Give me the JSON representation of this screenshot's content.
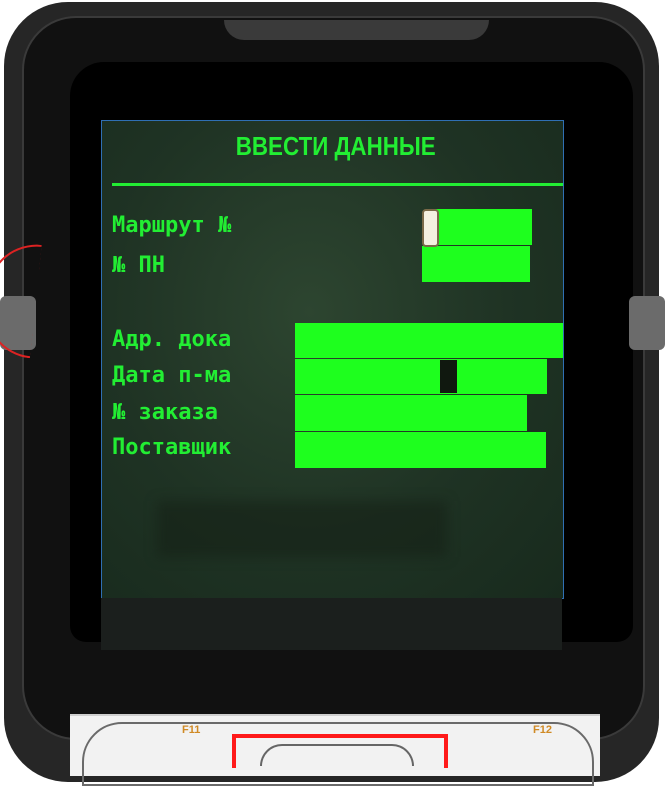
{
  "screen": {
    "title": "ВВЕСТИ ДАННЫЕ",
    "header_fields": [
      {
        "label": "Маршрут №",
        "value": ""
      },
      {
        "label": "№ ПН",
        "value": ""
      }
    ],
    "detail_fields": [
      {
        "label": "Адр. дока",
        "value": ""
      },
      {
        "label": "Дата п-ма",
        "value": ""
      },
      {
        "label": "№ заказа",
        "value": ""
      },
      {
        "label": "Поставщик",
        "value": ""
      }
    ]
  },
  "keypad": {
    "left_key": "F11",
    "right_key": "F12"
  },
  "colors": {
    "lcd_text": "#22ee33",
    "field_fill": "#1eff1e",
    "highlight": "#ff1a1a"
  }
}
